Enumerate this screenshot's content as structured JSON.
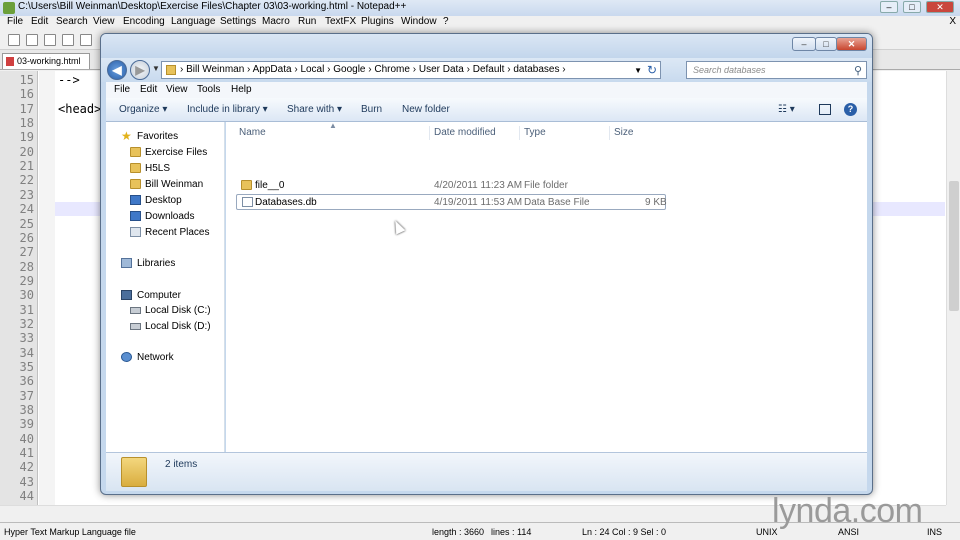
{
  "npp": {
    "title": "C:\\Users\\Bill Weinman\\Desktop\\Exercise Files\\Chapter 03\\03-working.html - Notepad++",
    "menu": [
      "File",
      "Edit",
      "Search",
      "View",
      "Encoding",
      "Language",
      "Settings",
      "Macro",
      "Run",
      "TextFX",
      "Plugins",
      "Window",
      "?"
    ],
    "close_x": "X",
    "tab": "03-working.html",
    "line_numbers": [
      "15",
      "16",
      "17",
      "18",
      "19",
      "20",
      "21",
      "22",
      "23",
      "24",
      "25",
      "26",
      "27",
      "28",
      "29",
      "30",
      "31",
      "32",
      "33",
      "34",
      "35",
      "36",
      "37",
      "38",
      "39",
      "40",
      "41",
      "42",
      "43",
      "44"
    ],
    "code": {
      "line15": "-->",
      "line17": "<head>"
    },
    "status": {
      "language": "Hyper Text Markup Language file",
      "length": "length : 3660",
      "lines": "lines : 114",
      "pos": "Ln : 24   Col : 9   Sel : 0",
      "eol": "UNIX",
      "enc": "ANSI",
      "ins": "INS"
    }
  },
  "explorer": {
    "address": [
      "Bill Weinman",
      "AppData",
      "Local",
      "Google",
      "Chrome",
      "User Data",
      "Default",
      "databases"
    ],
    "search_placeholder": "Search databases",
    "menu": [
      "File",
      "Edit",
      "View",
      "Tools",
      "Help"
    ],
    "commands": {
      "organize": "Organize ▾",
      "include": "Include in library ▾",
      "share": "Share with ▾",
      "burn": "Burn",
      "new_folder": "New folder"
    },
    "nav": {
      "favorites": "Favorites",
      "fav_items": [
        "Exercise Files",
        "H5LS",
        "Bill Weinman",
        "Desktop",
        "Downloads",
        "Recent Places"
      ],
      "libraries": "Libraries",
      "computer": "Computer",
      "drives": [
        "Local Disk (C:)",
        "Local Disk (D:)"
      ],
      "network": "Network"
    },
    "columns": {
      "name": "Name",
      "date": "Date modified",
      "type": "Type",
      "size": "Size"
    },
    "files": [
      {
        "name": "file__0",
        "date": "4/20/2011 11:23 AM",
        "type": "File folder",
        "size": ""
      },
      {
        "name": "Databases.db",
        "date": "4/19/2011 11:53 AM",
        "type": "Data Base File",
        "size": "9 KB"
      }
    ],
    "details": "2 items"
  },
  "watermark": "lynda.com"
}
